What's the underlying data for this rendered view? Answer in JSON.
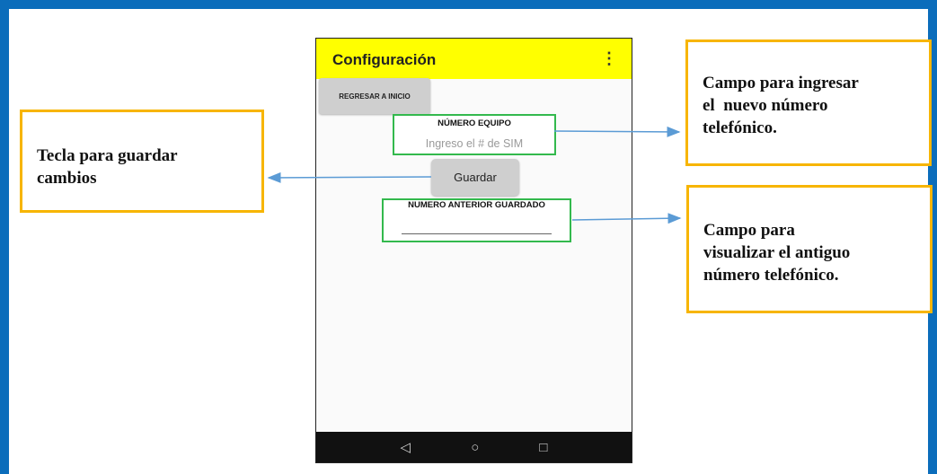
{
  "phone": {
    "app_title": "Configuración",
    "menu_icon": "⋮",
    "home_button": "REGRESAR A INICIO",
    "equipo_label": "NÚMERO EQUIPO",
    "equipo_placeholder": "Ingreso el # de SIM",
    "save_button": "Guardar",
    "anterior_label": "NUMERO ANTERIOR GUARDADO",
    "anterior_value": "",
    "nav": {
      "back": "◁",
      "home": "○",
      "recents": "□"
    },
    "accent_color": "#ffff00",
    "field_border_color": "#33b94d"
  },
  "annotations": {
    "save_key": [
      "Tecla para guardar",
      "cambios"
    ],
    "new_number": [
      "Campo para ingresar",
      "el  nuevo número",
      "telefónico."
    ],
    "old_number": [
      "Campo para",
      "visualizar el antiguo",
      "número telefónico."
    ],
    "box_color": "#f7b500",
    "arrow_color": "#5b9bd5"
  },
  "frame_color": "#0b6dbb"
}
